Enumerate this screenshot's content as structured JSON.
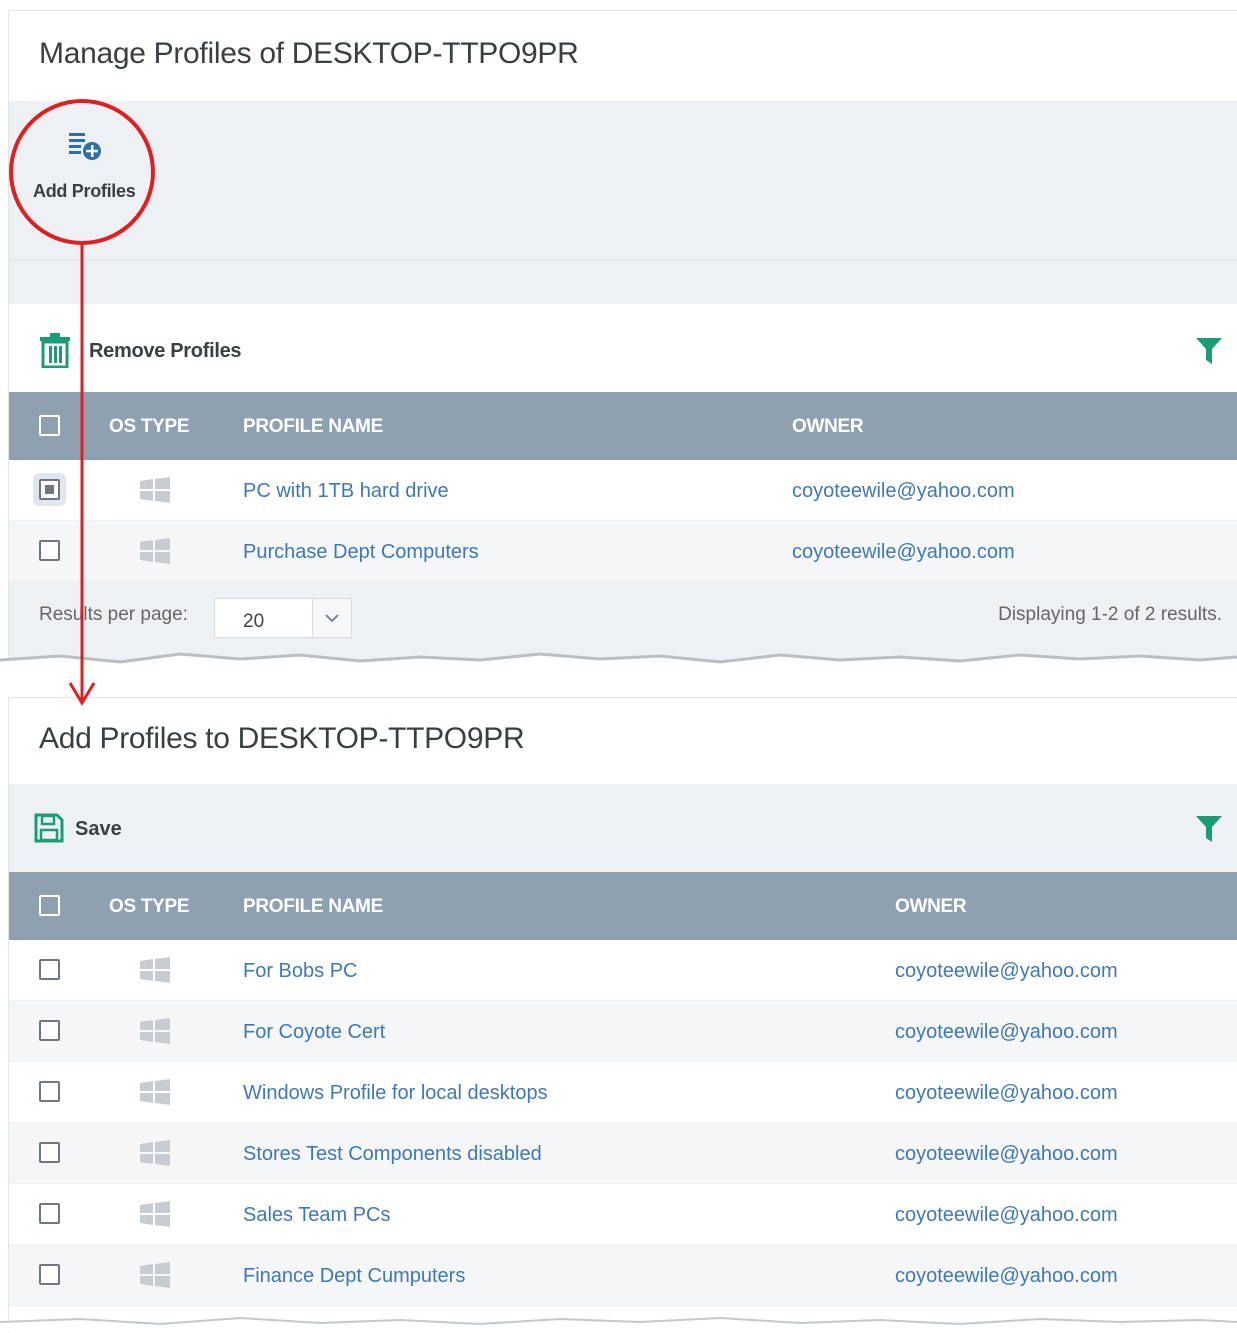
{
  "manage": {
    "title": "Manage Profiles of DESKTOP-TTPO9PR",
    "add_profiles_label": "Add Profiles",
    "remove_profiles_label": "Remove Profiles",
    "columns": {
      "os_type": "OS TYPE",
      "profile_name": "PROFILE NAME",
      "owner": "OWNER"
    },
    "rows": [
      {
        "name": "PC with 1TB hard drive",
        "owner": "coyoteewile@yahoo.com"
      },
      {
        "name": "Purchase Dept Computers",
        "owner": "coyoteewile@yahoo.com"
      }
    ],
    "results_per_page_label": "Results per page:",
    "results_per_page_value": "20",
    "displaying": "Displaying 1-2 of 2 results."
  },
  "add": {
    "title": "Add Profiles to DESKTOP-TTPO9PR",
    "save_label": "Save",
    "columns": {
      "os_type": "OS TYPE",
      "profile_name": "PROFILE NAME",
      "owner": "OWNER"
    },
    "rows": [
      {
        "name": "For Bobs PC",
        "owner": "coyoteewile@yahoo.com"
      },
      {
        "name": "For Coyote Cert",
        "owner": "coyoteewile@yahoo.com"
      },
      {
        "name": "Windows Profile for local desktops",
        "owner": "coyoteewile@yahoo.com"
      },
      {
        "name": "Stores Test Components disabled",
        "owner": "coyoteewile@yahoo.com"
      },
      {
        "name": "Sales Team PCs",
        "owner": "coyoteewile@yahoo.com"
      },
      {
        "name": "Finance Dept Cumputers",
        "owner": "coyoteewile@yahoo.com"
      }
    ]
  },
  "icons": {
    "add_profiles": "add-list-icon",
    "remove_profiles": "trash-icon",
    "filter": "filter-icon",
    "save": "save-icon",
    "os": "windows-icon"
  },
  "colors": {
    "header_bg": "#8fa1b0",
    "link": "#3e78b8",
    "accent_green": "#1a9d77",
    "annotation_red": "#e02020"
  }
}
